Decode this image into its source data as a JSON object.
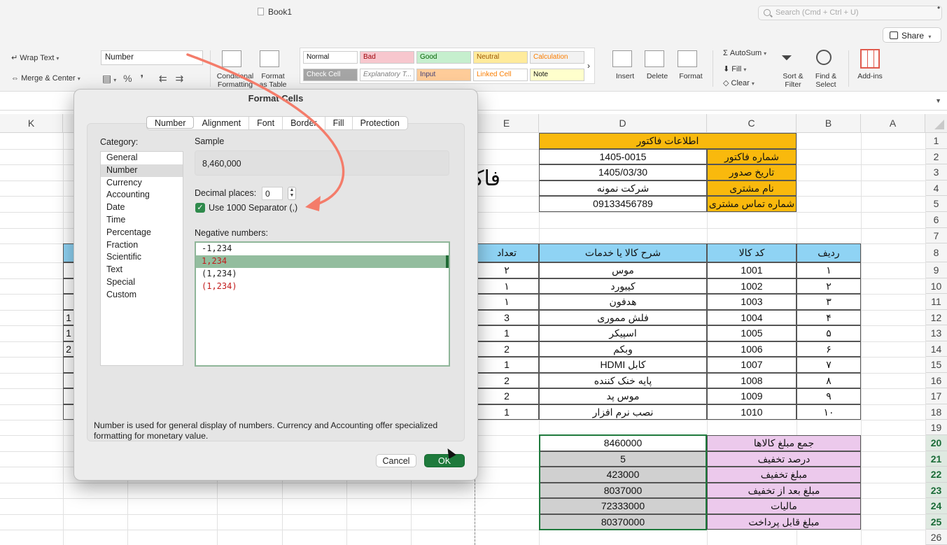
{
  "window": {
    "title": "Book1",
    "search_placeholder": "Search (Cmd + Ctrl + U)",
    "share_label": "Share",
    "more": "•"
  },
  "ribbon": {
    "wrap_text": "Wrap Text",
    "merge_center": "Merge & Center",
    "number_format": "Number",
    "conditional_formatting": [
      "Conditional",
      "Formatting"
    ],
    "format_as_table": [
      "Format",
      "as Table"
    ],
    "styles": [
      {
        "label": "Normal",
        "bg": "#ffffff",
        "color": "#111111"
      },
      {
        "label": "Bad",
        "bg": "#f7c7ce",
        "color": "#9c0006"
      },
      {
        "label": "Good",
        "bg": "#c6efce",
        "color": "#006100"
      },
      {
        "label": "Neutral",
        "bg": "#ffeb9c",
        "color": "#9c5700"
      },
      {
        "label": "Calculation",
        "bg": "#f2f2f2",
        "color": "#fa7d00"
      },
      {
        "label": "Check Cell",
        "bg": "#a5a5a5",
        "color": "#ffffff"
      },
      {
        "label": "Explanatory T...",
        "bg": "#ffffff",
        "color": "#7f7f7f"
      },
      {
        "label": "Input",
        "bg": "#ffcc99",
        "color": "#3f3f76"
      },
      {
        "label": "Linked Cell",
        "bg": "#ffffff",
        "color": "#fa7d00"
      },
      {
        "label": "Note",
        "bg": "#ffffcc",
        "color": "#111111"
      }
    ],
    "insert": "Insert",
    "delete": "Delete",
    "format": "Format",
    "autosum": "AutoSum",
    "fill": "Fill",
    "clear": "Clear",
    "sort_filter": [
      "Sort &",
      "Filter"
    ],
    "find_select": [
      "Find &",
      "Select"
    ],
    "add_ins": "Add-ins"
  },
  "grid": {
    "columns": [
      "K",
      "E",
      "D",
      "C",
      "B",
      "A"
    ],
    "rows": [
      "1",
      "2",
      "3",
      "4",
      "5",
      "6",
      "7",
      "8",
      "9",
      "10",
      "11",
      "12",
      "13",
      "14",
      "15",
      "16",
      "17",
      "18",
      "19",
      "20",
      "21",
      "22",
      "23",
      "24",
      "25",
      "26"
    ],
    "big_title": "فاکتور",
    "invoice_info": {
      "header": "اطلاعات فاکتور",
      "rows": [
        {
          "label": "شماره فاکتور",
          "value": "1405-0015"
        },
        {
          "label": "تاریخ صدور",
          "value": "1405/03/30"
        },
        {
          "label": "نام مشتری",
          "value": "شرکت نمونه"
        },
        {
          "label": "شماره تماس مشتری",
          "value": "09133456789"
        }
      ]
    },
    "table_headers": {
      "qty": "تعداد",
      "desc": "شرح کالا یا خدمات",
      "code": "کد کالا",
      "row": "ردیف"
    },
    "items": [
      {
        "qty": "۲",
        "desc": "موس",
        "code": "1001",
        "row": "۱"
      },
      {
        "qty": "۱",
        "desc": "کیبورد",
        "code": "1002",
        "row": "۲"
      },
      {
        "qty": "۱",
        "desc": "هدفون",
        "code": "1003",
        "row": "۳"
      },
      {
        "qty": "3",
        "desc": "فلش مموری",
        "code": "1004",
        "row": "۴"
      },
      {
        "qty": "1",
        "desc": "اسپیکر",
        "code": "1005",
        "row": "۵"
      },
      {
        "qty": "2",
        "desc": "وبکم",
        "code": "1006",
        "row": "۶"
      },
      {
        "qty": "1",
        "desc": "کابل HDMI",
        "code": "1007",
        "row": "۷"
      },
      {
        "qty": "2",
        "desc": "پایه خنک کننده",
        "code": "1008",
        "row": "۸"
      },
      {
        "qty": "2",
        "desc": "موس پد",
        "code": "1009",
        "row": "۹"
      },
      {
        "qty": "1",
        "desc": "نصب نرم افزار",
        "code": "1010",
        "row": "۱۰"
      }
    ],
    "left_partial": [
      "1",
      "1",
      "2"
    ],
    "summary": [
      {
        "label": "جمع مبلغ کالاها",
        "value": "8460000"
      },
      {
        "label": "درصد تخفیف",
        "value": "5"
      },
      {
        "label": "مبلغ تخفیف",
        "value": "423000"
      },
      {
        "label": "مبلغ بعد از تخفیف",
        "value": "8037000"
      },
      {
        "label": "مالیات",
        "value": "72333000"
      },
      {
        "label": "مبلغ قابل پرداخت",
        "value": "80370000"
      }
    ]
  },
  "dialog": {
    "title": "Format Cells",
    "tabs": [
      "Number",
      "Alignment",
      "Font",
      "Border",
      "Fill",
      "Protection"
    ],
    "category_label": "Category:",
    "categories": [
      "General",
      "Number",
      "Currency",
      "Accounting",
      "Date",
      "Time",
      "Percentage",
      "Fraction",
      "Scientific",
      "Text",
      "Special",
      "Custom"
    ],
    "selected_category": "Number",
    "sample_label": "Sample",
    "sample_value": "8,460,000",
    "decimal_label": "Decimal places:",
    "decimal_value": "0",
    "separator_label": "Use 1000 Separator (,)",
    "negative_label": "Negative numbers:",
    "negative_options": [
      "-1,234",
      "1,234",
      "(1,234)",
      "(1,234)"
    ],
    "description": "Number is used for general display of numbers.  Currency and Accounting offer specialized formatting for monetary value.",
    "cancel": "Cancel",
    "ok": "OK"
  },
  "colors": {
    "accent_green": "#1e7a3c",
    "annotation_arrow": "#f47c6a",
    "header_orange": "#f9b90d",
    "header_blue": "#8fd3f4",
    "summary_pink": "#ecc9ec"
  }
}
